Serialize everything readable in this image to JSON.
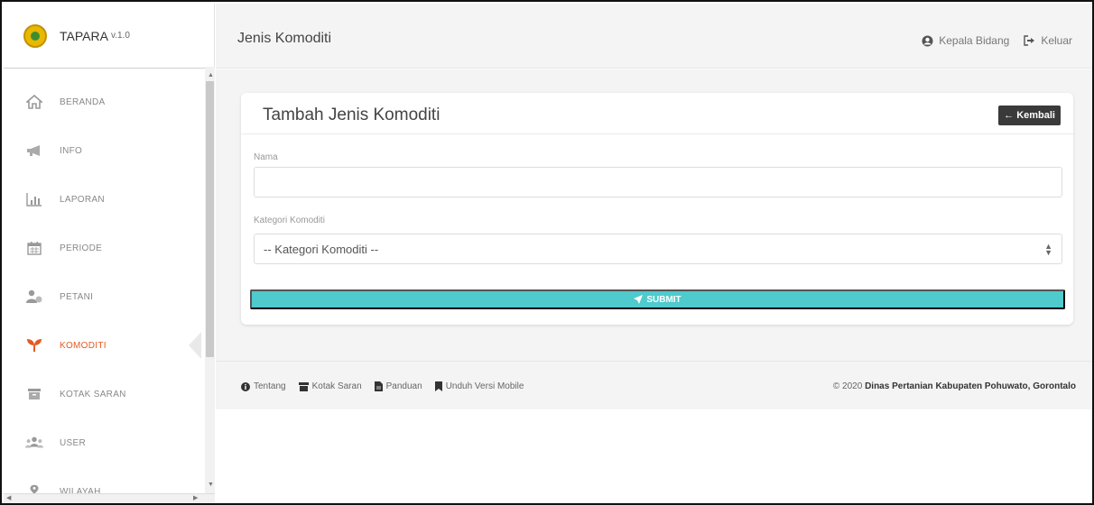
{
  "brand": {
    "name": "TAPARA",
    "version": "v.1.0"
  },
  "sidebar": {
    "items": [
      {
        "label": "BERANDA",
        "icon": "home-icon"
      },
      {
        "label": "INFO",
        "icon": "megaphone-icon"
      },
      {
        "label": "LAPORAN",
        "icon": "bar-chart-icon"
      },
      {
        "label": "PERIODE",
        "icon": "calendar-icon"
      },
      {
        "label": "PETANI",
        "icon": "users-icon"
      },
      {
        "label": "KOMODITI",
        "icon": "seedling-icon",
        "active": true
      },
      {
        "label": "KOTAK SARAN",
        "icon": "inbox-icon"
      },
      {
        "label": "USER",
        "icon": "user-group-icon"
      },
      {
        "label": "WILAYAH",
        "icon": "map-marker-icon"
      }
    ]
  },
  "header": {
    "title": "Jenis Komoditi",
    "user_label": "Kepala Bidang",
    "logout_label": "Keluar"
  },
  "form": {
    "title": "Tambah Jenis Komoditi",
    "back_label": "← Kembali",
    "name_label": "Nama",
    "name_value": "",
    "category_label": "Kategori Komoditi",
    "category_selected": "-- Kategori Komoditi --",
    "submit_label": "SUBMIT"
  },
  "footer": {
    "links": [
      {
        "label": "Tentang",
        "icon": "info-icon"
      },
      {
        "label": "Kotak Saran",
        "icon": "inbox-icon"
      },
      {
        "label": "Panduan",
        "icon": "file-icon"
      },
      {
        "label": "Unduh Versi Mobile",
        "icon": "bookmark-icon"
      }
    ],
    "copyright_prefix": "© 2020 ",
    "copyright_org": "Dinas Pertanian Kabupaten Pohuwato, Gorontalo"
  },
  "colors": {
    "active": "#e35a24",
    "submit": "#4fcacd",
    "back_button": "#3a3a3a",
    "background": "#f4f4f4"
  }
}
